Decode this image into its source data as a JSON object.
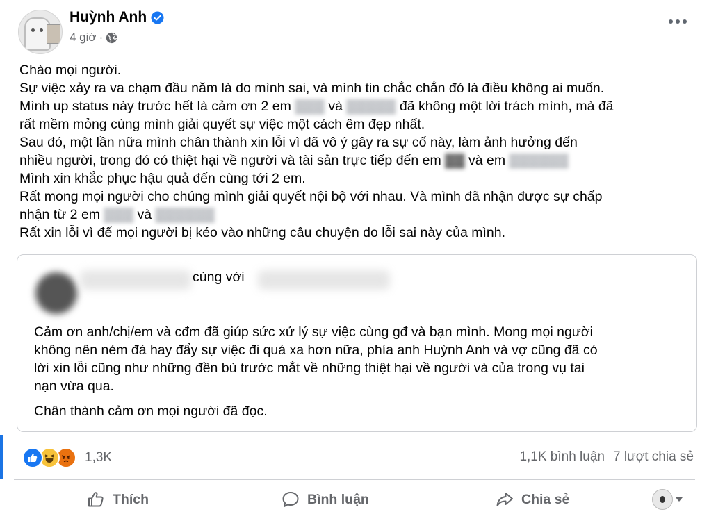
{
  "post": {
    "author": "Huỳnh Anh",
    "time": "4 giờ",
    "body": {
      "l1": "Chào mọi người.",
      "l2": "Sự việc xảy ra va chạm đầu năm là do mình sai, và mình tin chắc chắn đó là điều không ai muốn.",
      "l3a": "Mình up status này trước hết là cảm ơn 2 em",
      "l3b": "và",
      "l3c": "đã không một lời trách mình, mà đã",
      "l4": "rất mềm mỏng cùng mình giải quyết sự việc một cách êm đẹp nhất.",
      "l5": "Sau đó, một lần nữa mình chân thành xin lỗi vì đã vô ý gây ra sự cố này, làm ảnh hưởng đến",
      "l6a": "nhiều người, trong đó có thiệt hại về người và tài sản trực tiếp đến em",
      "l6b": "và em",
      "l7": "Mình xin khắc phục hậu quả đến cùng tới 2 em.",
      "l8": "Rất mong mọi người cho chúng mình giải quyết nội bộ với nhau. Và mình đã nhận được sự chấp",
      "l9a": "nhận từ 2 em",
      "l9b": "và",
      "l10": "Rất xin lỗi vì để mọi người bị kéo vào những câu chuyện do lỗi sai này của mình."
    }
  },
  "shared": {
    "with_text": "cùng với",
    "p1": {
      "l1": "Cảm ơn anh/chị/em và cđm đã giúp sức xử lý sự việc cùng gđ và bạn mình. Mong mọi người",
      "l2": "không nên ném đá hay đẩy sự việc đi quá xa hơn nữa, phía anh Huỳnh Anh và vợ cũng đã có",
      "l3": "lời xin lỗi cũng như những đền bù trước mắt về những thiệt hại về người và của trong vụ tai",
      "l4": "nạn vừa qua."
    },
    "p2": "Chân thành cảm ơn mọi người đã đọc."
  },
  "stats": {
    "reactions": "1,3K",
    "comments": "1,1K bình luận",
    "shares": "7 lượt chia sẻ"
  },
  "actions": {
    "like": "Thích",
    "comment": "Bình luận",
    "share": "Chia sẻ"
  },
  "icons": {
    "verified": "verified-badge-icon",
    "audience": "globe-icon",
    "more": "more-options-icon",
    "like": "thumbs-up-icon",
    "comment": "comment-bubble-icon",
    "share": "share-arrow-icon"
  },
  "colors": {
    "accent": "#1877f2",
    "secondary_text": "#65676b"
  }
}
